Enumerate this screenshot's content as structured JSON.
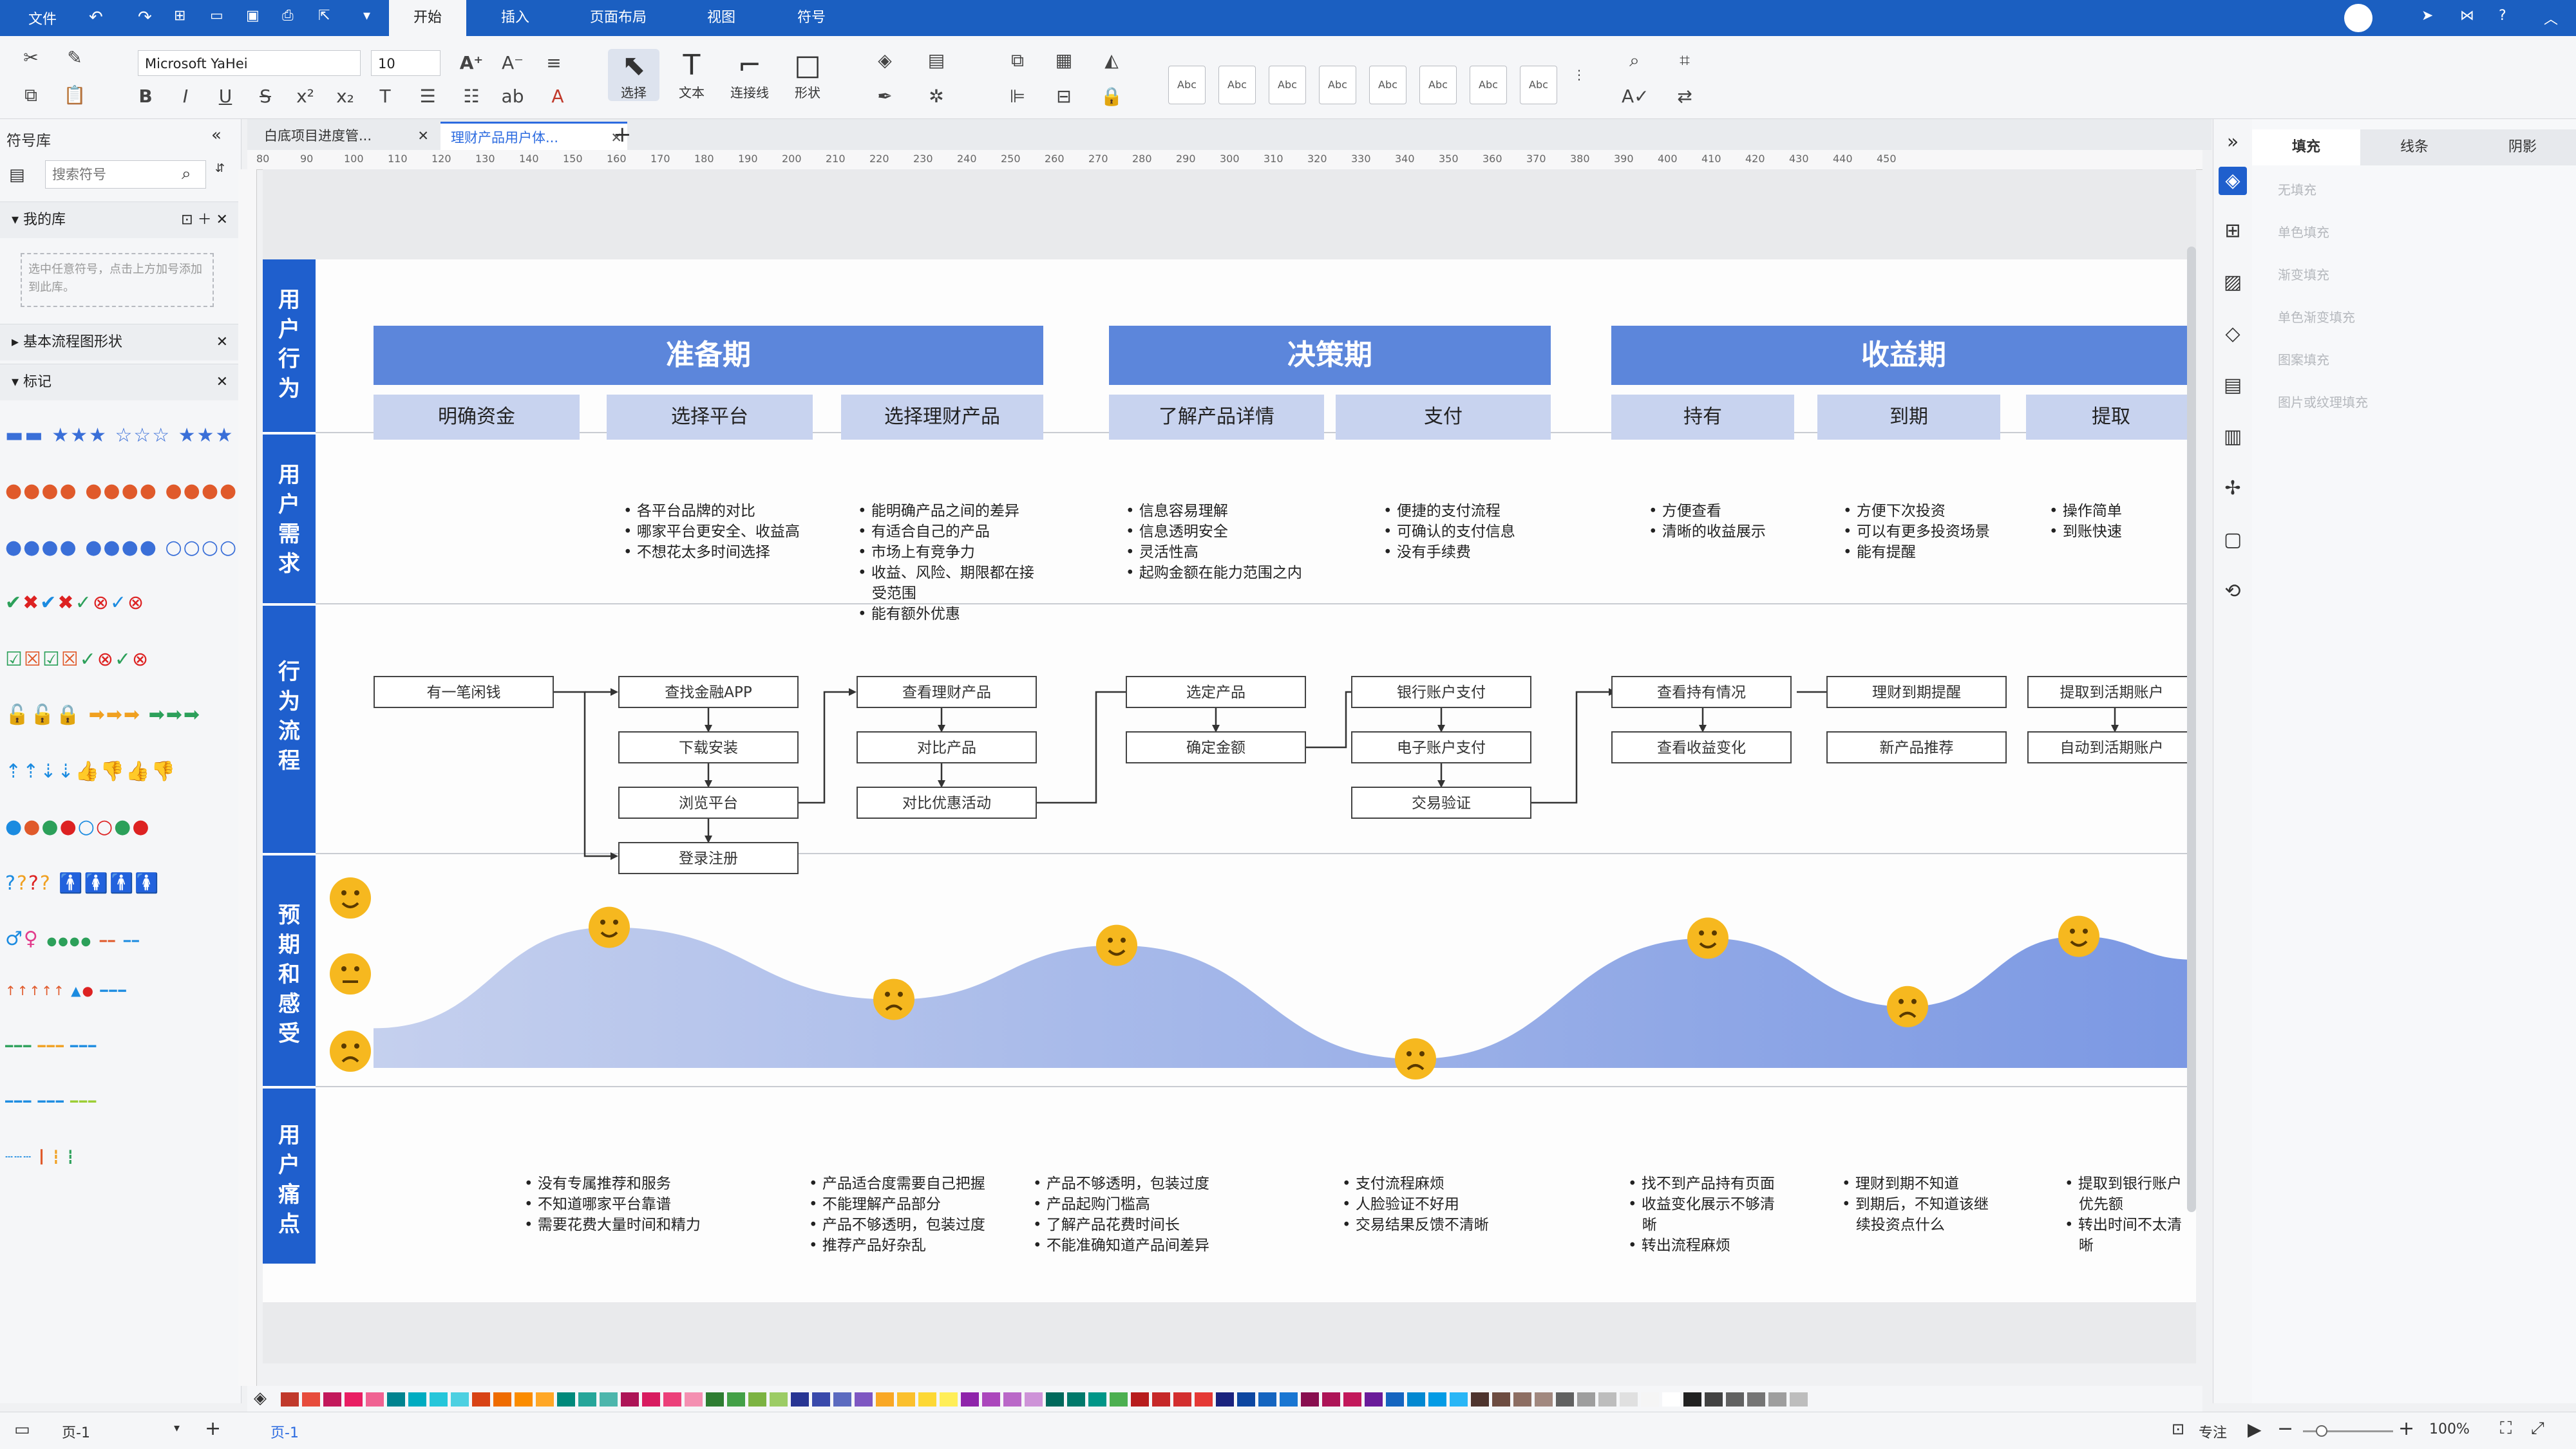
{
  "titlebar": {
    "menu_file": "文件",
    "tabs": [
      "开始",
      "插入",
      "页面布局",
      "视图",
      "符号"
    ]
  },
  "toolbar": {
    "font_name": "Microsoft YaHei",
    "font_size": "10",
    "select_label": "选择",
    "text_label": "文本",
    "connector_label": "连接线",
    "shape_label": "形状",
    "style_box_label": "Abc"
  },
  "left_panel": {
    "title": "符号库",
    "search_placeholder": "搜索符号",
    "my_library": "我的库",
    "my_library_hint": "选中任意符号，点击上方加号添加到此库。",
    "basic_flow": "基本流程图形状",
    "markers": "标记"
  },
  "doc_tabs": [
    "白底项目进度管...",
    "理财产品用户体..."
  ],
  "ruler_ticks": [
    "80",
    "90",
    "100",
    "110",
    "120",
    "130",
    "140",
    "150",
    "160",
    "170",
    "180",
    "190",
    "200",
    "210",
    "220",
    "230",
    "240",
    "250",
    "260",
    "270",
    "280",
    "290",
    "300",
    "310",
    "320",
    "330",
    "340",
    "350",
    "360",
    "370",
    "380",
    "390",
    "400",
    "410",
    "420",
    "430",
    "440",
    "450"
  ],
  "journey": {
    "lanes": [
      "用户行为",
      "用户需求",
      "行为流程",
      "预期和感受",
      "用户痛点"
    ],
    "phases": [
      "准备期",
      "决策期",
      "收益期"
    ],
    "stages": [
      "明确资金",
      "选择平台",
      "选择理财产品",
      "了解产品详情",
      "支付",
      "持有",
      "到期",
      "提取"
    ],
    "needs": [
      "",
      "• 各平台品牌的对比\n• 哪家平台更安全、收益高\n• 不想花太多时间选择",
      "• 能明确产品之间的差异\n• 有适合自己的产品\n• 市场上有竞争力\n• 收益、风险、期限都在接\n   受范围\n• 能有额外优惠",
      "• 信息容易理解\n• 信息透明安全\n• 灵活性高\n• 起购金额在能力范围之内",
      "• 便捷的支付流程\n• 可确认的支付信息\n• 没有手续费",
      "• 方便查看\n• 清晰的收益展示",
      "• 方便下次投资\n• 可以有更多投资场景\n• 能有提醒",
      "• 操作简单\n• 到账快速"
    ],
    "flow": {
      "start": "有一笔闲钱",
      "platform": [
        "查找金融APP",
        "下载安装",
        "浏览平台",
        "登录注册"
      ],
      "product": [
        "查看理财产品",
        "对比产品",
        "对比优惠活动"
      ],
      "detail": [
        "选定产品",
        "确定金额"
      ],
      "pay": [
        "银行账户支付",
        "电子账户支付",
        "交易验证"
      ],
      "hold": [
        "查看持有情况",
        "查看收益变化"
      ],
      "due": [
        "理财到期提醒",
        "新产品推荐"
      ],
      "withdraw": [
        "提取到活期账户",
        "自动到活期账户"
      ]
    },
    "emotion_scale": [
      "happy",
      "neutral",
      "sad"
    ],
    "emotion_levels": [
      0.78,
      0.38,
      0.68,
      0.05,
      0.72,
      0.34,
      0.73
    ],
    "pains": [
      "• 没有专属推荐和服务\n• 不知道哪家平台靠谱\n• 需要花费大量时间和精力",
      "• 产品适合度需要自己把握\n• 不能理解产品部分\n• 产品不够透明，包装过度\n• 推荐产品好杂乱",
      "• 产品不够透明，包装过度\n• 产品起购门槛高\n• 了解产品花费时间长\n• 不能准确知道产品间差异",
      "• 支付流程麻烦\n• 人脸验证不好用\n• 交易结果反馈不清晰",
      "• 找不到产品持有页面\n• 收益变化展示不够清\n   晰\n• 转出流程麻烦",
      "• 理财到期不知道\n• 到期后，不知道该继\n   续投资点什么",
      "• 提取到银行账户\n   优先额\n• 转出时间不太清\n   晰"
    ]
  },
  "right_panel": {
    "tabs": [
      "填充",
      "线条",
      "阴影"
    ],
    "fill_options": [
      "无填充",
      "单色填充",
      "渐变填充",
      "单色渐变填充",
      "图案填充",
      "图片或纹理填充"
    ]
  },
  "colors": {
    "brand": "#1b5fc1",
    "lane": "#1f5fcd",
    "phase": "#5c86db",
    "stage": "#c8d3ef",
    "wave": "#9fb3e6",
    "emoji": "#f6b81f"
  },
  "palette": [
    "#c0392b",
    "#e74c3c",
    "#c2185b",
    "#e91e63",
    "#f06292",
    "#00838f",
    "#00acc1",
    "#26c6da",
    "#4dd0e1",
    "#d84315",
    "#ef6c00",
    "#fb8c00",
    "#ffa726",
    "#00897b",
    "#26a69a",
    "#4db6ac",
    "#ad1457",
    "#d81b60",
    "#ec407a",
    "#f48fb1",
    "#2e7d32",
    "#43a047",
    "#7cb342",
    "#9ccc65",
    "#283593",
    "#3949ab",
    "#5c6bc0",
    "#7e57c2",
    "#f9a825",
    "#fbc02d",
    "#fdd835",
    "#ffee58",
    "#8e24aa",
    "#ab47bc",
    "#ba68c8",
    "#ce93d8",
    "#00695c",
    "#00796b",
    "#009688",
    "#4caf50",
    "#b71c1c",
    "#c62828",
    "#d32f2f",
    "#e53935",
    "#1a237e",
    "#0d47a1",
    "#1565c0",
    "#1976d2",
    "#880e4f",
    "#ad1457",
    "#c2185b",
    "#6a1b9a",
    "#1565c0",
    "#0288d1",
    "#039be5",
    "#29b6f6",
    "#4e342e",
    "#6d4c41",
    "#8d6e63",
    "#a1887f",
    "#616161",
    "#9e9e9e",
    "#bdbdbd",
    "#e0e0e0",
    "#f5f5f5",
    "#ffffff",
    "#212121",
    "#424242",
    "#616161",
    "#757575",
    "#9e9e9e",
    "#bdbdbd"
  ],
  "status": {
    "page_name": "页-1",
    "page_tab": "页-1",
    "focus": "专注",
    "zoom": "100%"
  }
}
